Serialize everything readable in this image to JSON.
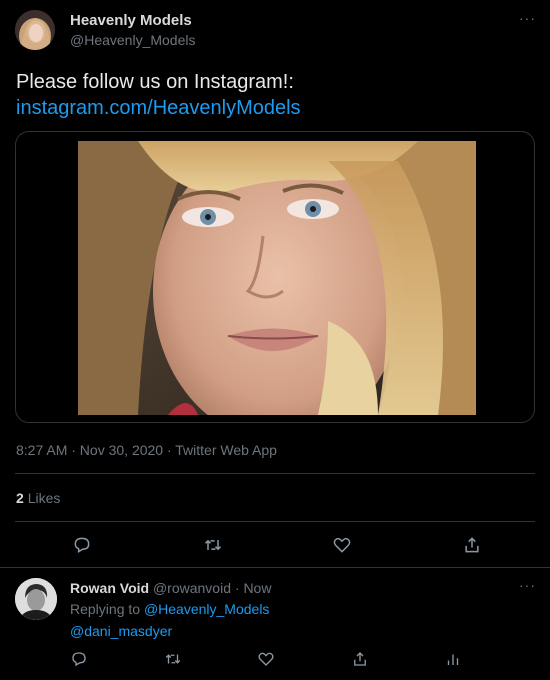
{
  "tweet": {
    "author_name": "Heavenly Models",
    "author_handle": "@Heavenly_Models",
    "text": "Please follow us on Instagram!:",
    "link": "instagram.com/HeavenlyModels",
    "timestamp": "8:27 AM · Nov 30, 2020 · Twitter Web App",
    "likes_count": "2",
    "likes_label": "Likes",
    "more_label": "···"
  },
  "reply": {
    "author_name": "Rowan Void",
    "author_handle": "@rowanvoid",
    "time": "· Now",
    "replying_prefix": "Replying to",
    "mention1": "@Heavenly_Models",
    "mention2": "@dani_masdyer",
    "more_label": "···"
  },
  "actions": [
    "reply-icon",
    "retweet-icon",
    "like-icon",
    "share-icon"
  ],
  "reply_actions": [
    "reply-icon",
    "retweet-icon",
    "like-icon",
    "share-icon",
    "analytics-icon"
  ],
  "colors": {
    "background": "#000000",
    "link": "#1d9bf0",
    "muted": "#6e767d",
    "border": "#2f3336"
  }
}
